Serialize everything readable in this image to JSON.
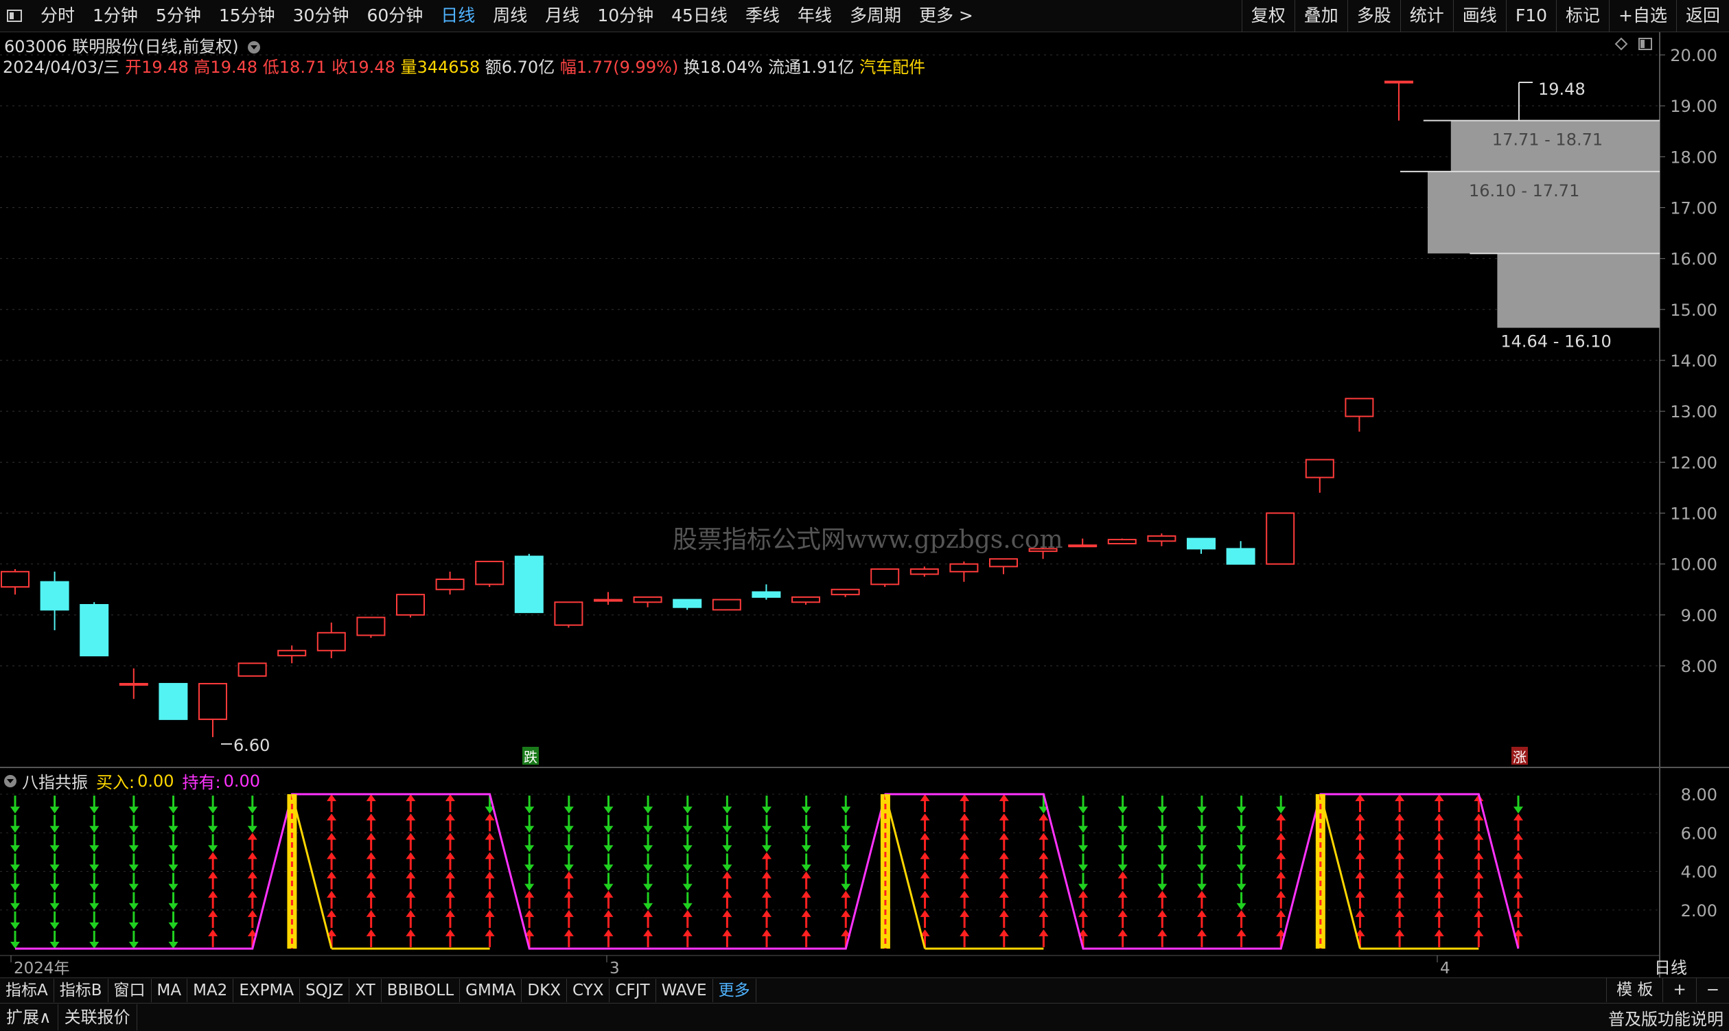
{
  "topbar": {
    "tabs": [
      "分时",
      "1分钟",
      "5分钟",
      "15分钟",
      "30分钟",
      "60分钟",
      "日线",
      "周线",
      "月线",
      "10分钟",
      "45日线",
      "季线",
      "年线",
      "多周期",
      "更多 >"
    ],
    "active_tab": "日线",
    "right_buttons": [
      "复权",
      "叠加",
      "多股",
      "统计",
      "画线",
      "F10",
      "标记",
      "+自选",
      "返回"
    ]
  },
  "stock": {
    "code_name": "603006 联明股份(日线,前复权)",
    "date": "2024/04/03/三",
    "open_label": "开",
    "open": "19.48",
    "high_label": "高",
    "high": "19.48",
    "low_label": "低",
    "low": "18.71",
    "close_label": "收",
    "close": "19.48",
    "vol_label": "量",
    "vol": "344658",
    "amount_label": "额",
    "amount": "6.70亿",
    "change_label": "幅",
    "change": "1.77(9.99%)",
    "turnover_label": "换",
    "turnover": "18.04%",
    "float_label": "流通",
    "float": "1.91亿",
    "sector": "汽车配件"
  },
  "watermark": "股票指标公式网www.gpzbgs.com",
  "indicator": {
    "name": "八指共振",
    "buy_label": "买入:",
    "buy": "0.00",
    "hold_label": "持有:",
    "hold": "0.00"
  },
  "chart_data": {
    "type": "candlestick",
    "price_axis": [
      "20.00",
      "19.00",
      "18.00",
      "17.00",
      "16.00",
      "15.00",
      "14.00",
      "13.00",
      "12.00",
      "11.00",
      "10.00",
      "9.00",
      "8.00"
    ],
    "indicator_axis": [
      "8.00",
      "6.00",
      "4.00",
      "2.00"
    ],
    "x_labels": [
      "2024年",
      "3",
      "4"
    ],
    "candles": [
      {
        "o": 9.55,
        "h": 9.9,
        "l": 9.4,
        "c": 9.85
      },
      {
        "o": 9.65,
        "h": 9.85,
        "l": 8.7,
        "c": 9.1
      },
      {
        "o": 9.2,
        "h": 9.25,
        "l": 8.2,
        "c": 8.2
      },
      {
        "o": 7.65,
        "h": 7.95,
        "l": 7.35,
        "c": 7.65
      },
      {
        "o": 7.65,
        "h": 7.65,
        "l": 6.95,
        "c": 6.95
      },
      {
        "o": 6.95,
        "h": 7.65,
        "l": 6.6,
        "c": 7.65
      },
      {
        "o": 7.8,
        "h": 8.05,
        "l": 7.8,
        "c": 8.05
      },
      {
        "o": 8.2,
        "h": 8.4,
        "l": 8.05,
        "c": 8.3
      },
      {
        "o": 8.3,
        "h": 8.85,
        "l": 8.15,
        "c": 8.65
      },
      {
        "o": 8.6,
        "h": 8.95,
        "l": 8.55,
        "c": 8.95
      },
      {
        "o": 9,
        "h": 9.4,
        "l": 8.95,
        "c": 9.4
      },
      {
        "o": 9.5,
        "h": 9.85,
        "l": 9.4,
        "c": 9.7
      },
      {
        "o": 9.6,
        "h": 10.05,
        "l": 9.55,
        "c": 10.05
      },
      {
        "o": 10.15,
        "h": 10.2,
        "l": 9.05,
        "c": 9.05
      },
      {
        "o": 8.8,
        "h": 9.25,
        "l": 8.75,
        "c": 9.25
      },
      {
        "o": 9.3,
        "h": 9.45,
        "l": 9.2,
        "c": 9.3
      },
      {
        "o": 9.25,
        "h": 9.35,
        "l": 9.15,
        "c": 9.35
      },
      {
        "o": 9.3,
        "h": 9.3,
        "l": 9.1,
        "c": 9.15
      },
      {
        "o": 9.1,
        "h": 9.3,
        "l": 9.1,
        "c": 9.3
      },
      {
        "o": 9.45,
        "h": 9.6,
        "l": 9.3,
        "c": 9.35
      },
      {
        "o": 9.25,
        "h": 9.35,
        "l": 9.2,
        "c": 9.35
      },
      {
        "o": 9.4,
        "h": 9.5,
        "l": 9.35,
        "c": 9.5
      },
      {
        "o": 9.6,
        "h": 9.9,
        "l": 9.55,
        "c": 9.9
      },
      {
        "o": 9.8,
        "h": 9.95,
        "l": 9.75,
        "c": 9.9
      },
      {
        "o": 9.85,
        "h": 10.05,
        "l": 9.65,
        "c": 10
      },
      {
        "o": 9.95,
        "h": 10.1,
        "l": 9.8,
        "c": 10.1
      },
      {
        "o": 10.25,
        "h": 10.35,
        "l": 10.1,
        "c": 10.3
      },
      {
        "o": 10.35,
        "h": 10.5,
        "l": 10.35,
        "c": 10.37
      },
      {
        "o": 10.4,
        "h": 10.5,
        "l": 10.4,
        "c": 10.48
      },
      {
        "o": 10.45,
        "h": 10.6,
        "l": 10.35,
        "c": 10.55
      },
      {
        "o": 10.5,
        "h": 10.5,
        "l": 10.2,
        "c": 10.3
      },
      {
        "o": 10.3,
        "h": 10.45,
        "l": 10,
        "c": 10
      },
      {
        "o": 10,
        "h": 11,
        "l": 10,
        "c": 11
      },
      {
        "o": 11.7,
        "h": 12.05,
        "l": 11.4,
        "c": 12.05
      },
      {
        "o": 12.9,
        "h": 13.25,
        "l": 12.6,
        "c": 13.25
      },
      {
        "o": 19.48,
        "h": 19.48,
        "l": 18.71,
        "c": 19.48
      }
    ],
    "annotations": {
      "low": "6.60",
      "high": "19.48",
      "down": "跌",
      "up": "涨"
    },
    "chip_bands": [
      {
        "range": "17.71 - 18.71",
        "low": 17.71,
        "high": 18.71
      },
      {
        "range": "16.10 - 17.71",
        "low": 16.1,
        "high": 17.71
      },
      {
        "range": "14.64 - 16.10",
        "low": 14.64,
        "high": 16.1
      }
    ],
    "chip_widths": [
      0.9,
      1.0,
      0.7
    ],
    "indicator_arrows": [
      {
        "up": 0,
        "down": 8
      },
      {
        "up": 0,
        "down": 8
      },
      {
        "up": 0,
        "down": 8
      },
      {
        "up": 0,
        "down": 8
      },
      {
        "up": 0,
        "down": 8
      },
      {
        "up": 5,
        "down": 3
      },
      {
        "up": 6,
        "down": 2
      },
      {
        "up": 8,
        "down": 0
      },
      {
        "up": 8,
        "down": 0
      },
      {
        "up": 8,
        "down": 0
      },
      {
        "up": 8,
        "down": 0
      },
      {
        "up": 8,
        "down": 0
      },
      {
        "up": 7,
        "down": 1
      },
      {
        "up": 3,
        "down": 5
      },
      {
        "up": 4,
        "down": 4
      },
      {
        "up": 3,
        "down": 5
      },
      {
        "up": 2,
        "down": 6
      },
      {
        "up": 2,
        "down": 6
      },
      {
        "up": 4,
        "down": 4
      },
      {
        "up": 5,
        "down": 3
      },
      {
        "up": 4,
        "down": 4
      },
      {
        "up": 3,
        "down": 5
      },
      {
        "up": 8,
        "down": 0
      },
      {
        "up": 8,
        "down": 0
      },
      {
        "up": 8,
        "down": 0
      },
      {
        "up": 8,
        "down": 0
      },
      {
        "up": 7,
        "down": 1
      },
      {
        "up": 3,
        "down": 5
      },
      {
        "up": 4,
        "down": 4
      },
      {
        "up": 3,
        "down": 5
      },
      {
        "up": 3,
        "down": 5
      },
      {
        "up": 2,
        "down": 6
      },
      {
        "up": 7,
        "down": 1
      },
      {
        "up": 8,
        "down": 0
      },
      {
        "up": 8,
        "down": 0
      },
      {
        "up": 8,
        "down": 0
      },
      {
        "up": 8,
        "down": 0
      },
      {
        "up": 8,
        "down": 0
      },
      {
        "up": 7,
        "down": 1
      }
    ],
    "signal_bars": [
      7,
      22,
      33
    ]
  },
  "bottom_tabs": [
    "指标A",
    "指标B",
    "窗口",
    "MA",
    "MA2",
    "EXPMA",
    "SQJZ",
    "XT",
    "BBIBOLL",
    "GMMA",
    "DKX",
    "CYX",
    "CFJT",
    "WAVE",
    "更多"
  ],
  "bottom_tabs_active": "更多",
  "bottom_right": [
    "模 板",
    "+",
    "−"
  ],
  "bottom2_left": [
    "扩展∧",
    "关联报价"
  ],
  "bottom2_right": "普及版功能说明",
  "dayline_label": "日线"
}
